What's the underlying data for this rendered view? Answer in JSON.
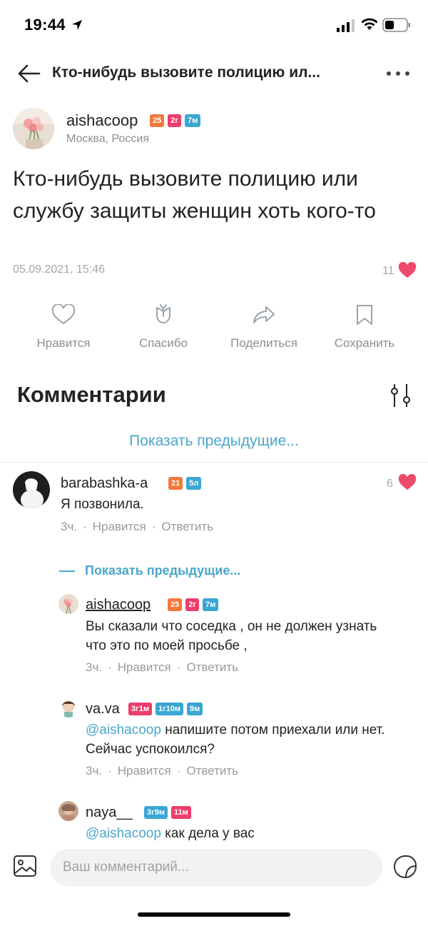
{
  "status_bar": {
    "time": "19:44"
  },
  "header": {
    "title": "Кто-нибудь вызовите полицию ил..."
  },
  "post": {
    "author": {
      "username": "aishacoop",
      "badges": [
        {
          "text": "25",
          "color": "#f2783a"
        },
        {
          "text": "2г",
          "color": "#ec3d6d"
        },
        {
          "text": "7м",
          "color": "#3aa6d4"
        }
      ],
      "location": "Москва, Россия"
    },
    "text": "Кто-нибудь вызовите полицию или службу защиты  женщин хоть кого-то",
    "date": "05.09.2021, 15:46",
    "likes": "11"
  },
  "actions": {
    "like": "Нравится",
    "thanks": "Спасибо",
    "share": "Поделиться",
    "save": "Сохранить"
  },
  "comments_section": {
    "title": "Комментарии",
    "show_previous": "Показать предыдущие...",
    "comments": [
      {
        "username": "barabashka-a",
        "badges": [
          {
            "text": "21",
            "color": "#f2783a"
          },
          {
            "text": "5л",
            "color": "#3aa6d4"
          }
        ],
        "text": "Я позвонила.",
        "time": "3ч.",
        "like": "Нравится",
        "reply": "Ответить",
        "likes": "6"
      }
    ],
    "replies_show_previous": "Показать предыдущие...",
    "replies": [
      {
        "username": "aishacoop",
        "badges": [
          {
            "text": "25",
            "color": "#f2783a"
          },
          {
            "text": "2г",
            "color": "#ec3d6d"
          },
          {
            "text": "7м",
            "color": "#3aa6d4"
          }
        ],
        "text": "Вы сказали что соседка , он не должен узнать что это по моей просьбе ,",
        "time": "3ч.",
        "like": "Нравится",
        "reply": "Ответить"
      },
      {
        "username": "va.va",
        "badges": [
          {
            "text": "3г1м",
            "color": "#ec3d6d"
          },
          {
            "text": "1г10м",
            "color": "#3aa6d4"
          },
          {
            "text": "9м",
            "color": "#3aa6d4"
          }
        ],
        "mention": "@aishacoop",
        "text": " напишите потом приехали или нет. Сейчас успокоился?",
        "time": "3ч.",
        "like": "Нравится",
        "reply": "Ответить"
      },
      {
        "username": "naya__",
        "badges": [
          {
            "text": "3г9м",
            "color": "#3aa6d4"
          },
          {
            "text": "11м",
            "color": "#ec3d6d"
          }
        ],
        "mention": "@aishacoop",
        "text": " как дела у вас"
      }
    ]
  },
  "composer": {
    "placeholder": "Ваш комментарий..."
  },
  "colors": {
    "accent": "#4aa7c9",
    "heart": "#ee4a6b",
    "muted": "#8e8e8e"
  }
}
